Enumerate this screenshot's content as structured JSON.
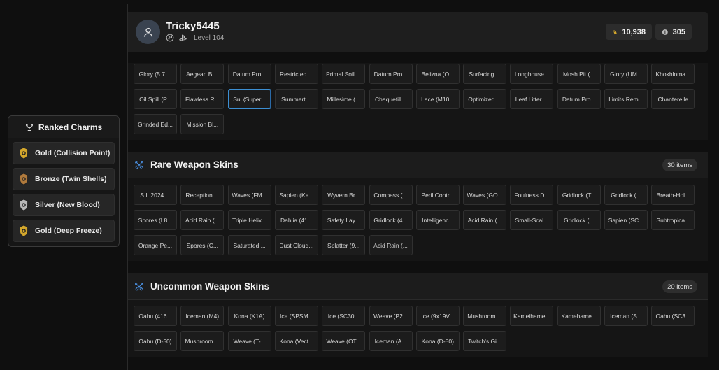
{
  "charms_panel": {
    "title": "Ranked Charms",
    "items": [
      {
        "label": "Gold (Collision Point)",
        "tier": "gold"
      },
      {
        "label": "Bronze (Twin Shells)",
        "tier": "bronze"
      },
      {
        "label": "Silver (New Blood)",
        "tier": "silver"
      },
      {
        "label": "Gold (Deep Freeze)",
        "tier": "gold"
      }
    ]
  },
  "profile": {
    "username": "Tricky5445",
    "level": "Level 104",
    "platform_icons": [
      "steam-icon",
      "playstation-icon"
    ],
    "credits": "10,938",
    "coins": "305"
  },
  "top_section": {
    "items": [
      "Glory (5.7 ...",
      "Aegean Bl...",
      "Datum Pro...",
      "Restricted ...",
      "Primal Soil ...",
      "Datum Pro...",
      "Belizna (O...",
      "Surfacing ...",
      "Longhouse...",
      "Mosh Pit (...",
      "Glory (UM...",
      "Khokhloma...",
      "Oil Spill (P...",
      "Flawless R...",
      "Sui (Super...",
      "Summerti...",
      "Millesime (...",
      "Chaquetill...",
      "Lace (M10...",
      "Optimized ...",
      "Leaf Litter ...",
      "Datum Pro...",
      "Limits Rem...",
      "Chanterelle",
      "Grinded Ed...",
      "Mission Bl..."
    ],
    "selected_index": 14
  },
  "rare_section": {
    "title": "Rare Weapon Skins",
    "count": "30 items",
    "items": [
      "S.I. 2024 ...",
      "Reception ...",
      "Waves (FM...",
      "Sapien (Ke...",
      "Wyvern Br...",
      "Compass (...",
      "Peril Contr...",
      "Waves (GO...",
      "Foulness D...",
      "Gridlock (T...",
      "Gridlock (...",
      "Breath-Hol...",
      "Spores (L8...",
      "Acid Rain (...",
      "Triple Helix...",
      "Dahlia (41...",
      "Safety Lay...",
      "Gridlock (4...",
      "Intelligenc...",
      "Acid Rain (...",
      "Small-Scal...",
      "Gridlock (...",
      "Sapien (SC...",
      "Subtropica...",
      "Orange Pe...",
      "Spores (C...",
      "Saturated ...",
      "Dust Cloud...",
      "Splatter (9...",
      "Acid Rain (..."
    ]
  },
  "uncommon_section": {
    "title": "Uncommon Weapon Skins",
    "count": "20 items",
    "items": [
      "Oahu (416...",
      "Iceman (M4)",
      "Kona (K1A)",
      "Ice (SPSM...",
      "Ice (SC30...",
      "Weave (P2...",
      "Ice (9x19V...",
      "Mushroom ...",
      "Kameihame...",
      "Kamehame...",
      "Iceman (S...",
      "Oahu (SC3...",
      "Oahu (D-50)",
      "Mushroom ...",
      "Weave (T-...",
      "Kona (Vect...",
      "Weave (OT...",
      "Iceman (A...",
      "Kona (D-50)",
      "Twitch's Gi..."
    ]
  },
  "colors": {
    "gold": "#d4a72c",
    "bronze": "#b07a3c",
    "silver": "#b8b8b8",
    "accent_blue": "#3c8fd3"
  }
}
